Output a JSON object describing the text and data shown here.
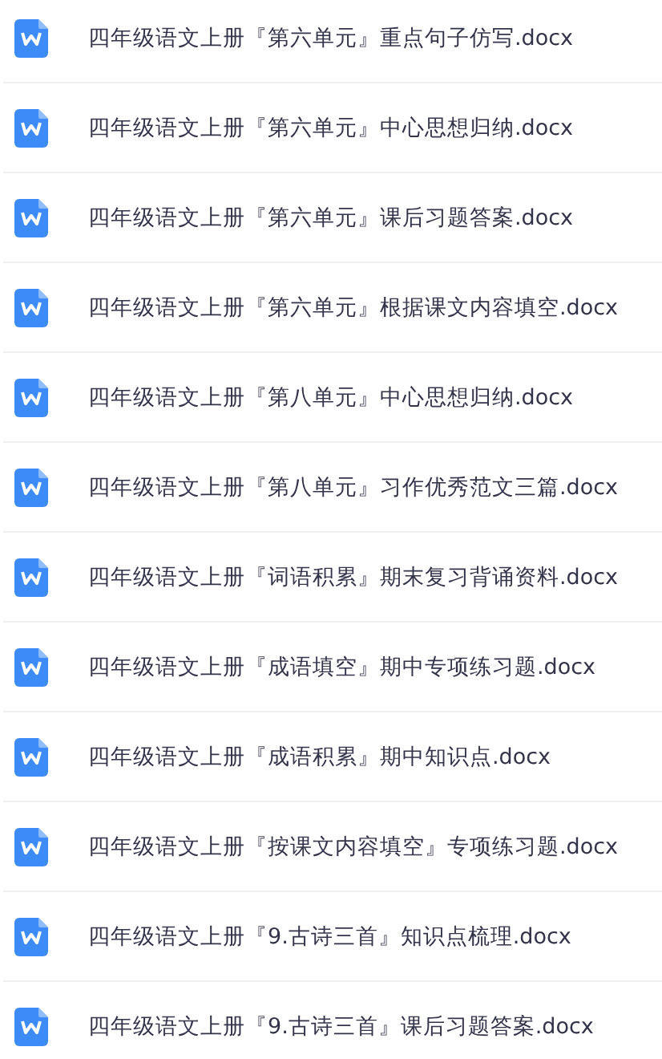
{
  "files": [
    {
      "name": "四年级语文上册『第六单元』重点句子仿写.docx"
    },
    {
      "name": "四年级语文上册『第六单元』中心思想归纳.docx"
    },
    {
      "name": "四年级语文上册『第六单元』课后习题答案.docx"
    },
    {
      "name": "四年级语文上册『第六单元』根据课文内容填空.docx"
    },
    {
      "name": "四年级语文上册『第八单元』中心思想归纳.docx"
    },
    {
      "name": "四年级语文上册『第八单元』习作优秀范文三篇.docx"
    },
    {
      "name": "四年级语文上册『词语积累』期末复习背诵资料.docx"
    },
    {
      "name": "四年级语文上册『成语填空』期中专项练习题.docx"
    },
    {
      "name": "四年级语文上册『成语积累』期中知识点.docx"
    },
    {
      "name": "四年级语文上册『按课文内容填空』专项练习题.docx"
    },
    {
      "name": "四年级语文上册『9.古诗三首』知识点梳理.docx"
    },
    {
      "name": "四年级语文上册『9.古诗三首』课后习题答案.docx"
    }
  ]
}
